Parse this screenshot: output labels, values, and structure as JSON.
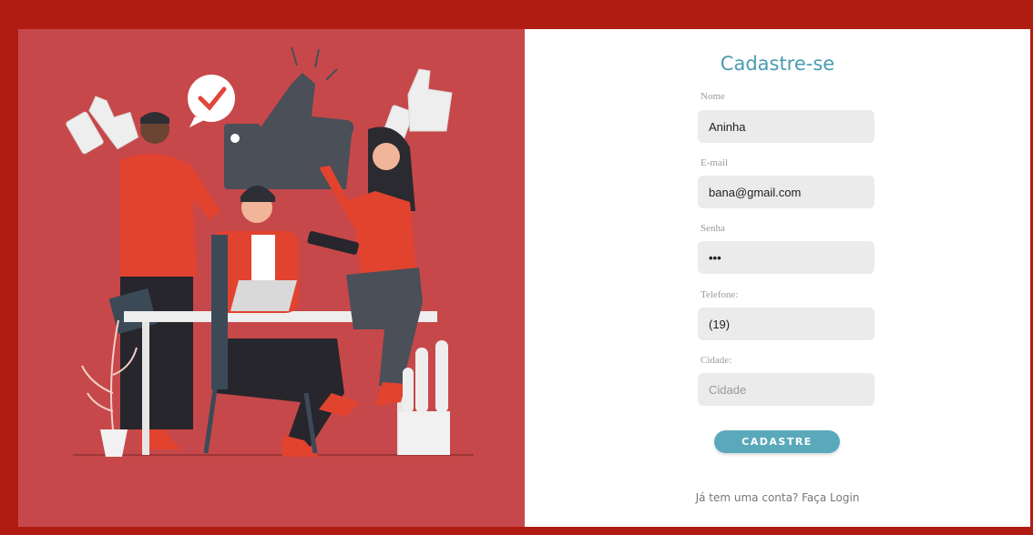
{
  "form": {
    "title": "Cadastre-se",
    "fields": [
      {
        "label": "Nome",
        "value": "Aninha",
        "placeholder": "Nome",
        "type": "text"
      },
      {
        "label": "E-mail",
        "value": "bana@gmail.com",
        "placeholder": "E-mail",
        "type": "text"
      },
      {
        "label": "Senha",
        "value": "•••",
        "placeholder": "Senha",
        "type": "text"
      },
      {
        "label": "Telefone:",
        "value": "(19)",
        "placeholder": "Telefone",
        "type": "text"
      },
      {
        "label": "Cidade:",
        "value": "",
        "placeholder": "Cidade",
        "type": "text"
      }
    ],
    "submit_label": "CADASTRE",
    "login_text": "Já tem uma conta? Faça Login"
  },
  "colors": {
    "outer_background": "#b11c12",
    "illustration_background": "#c7484a",
    "accent": "#5aa9bb",
    "title": "#4a9cb0"
  }
}
